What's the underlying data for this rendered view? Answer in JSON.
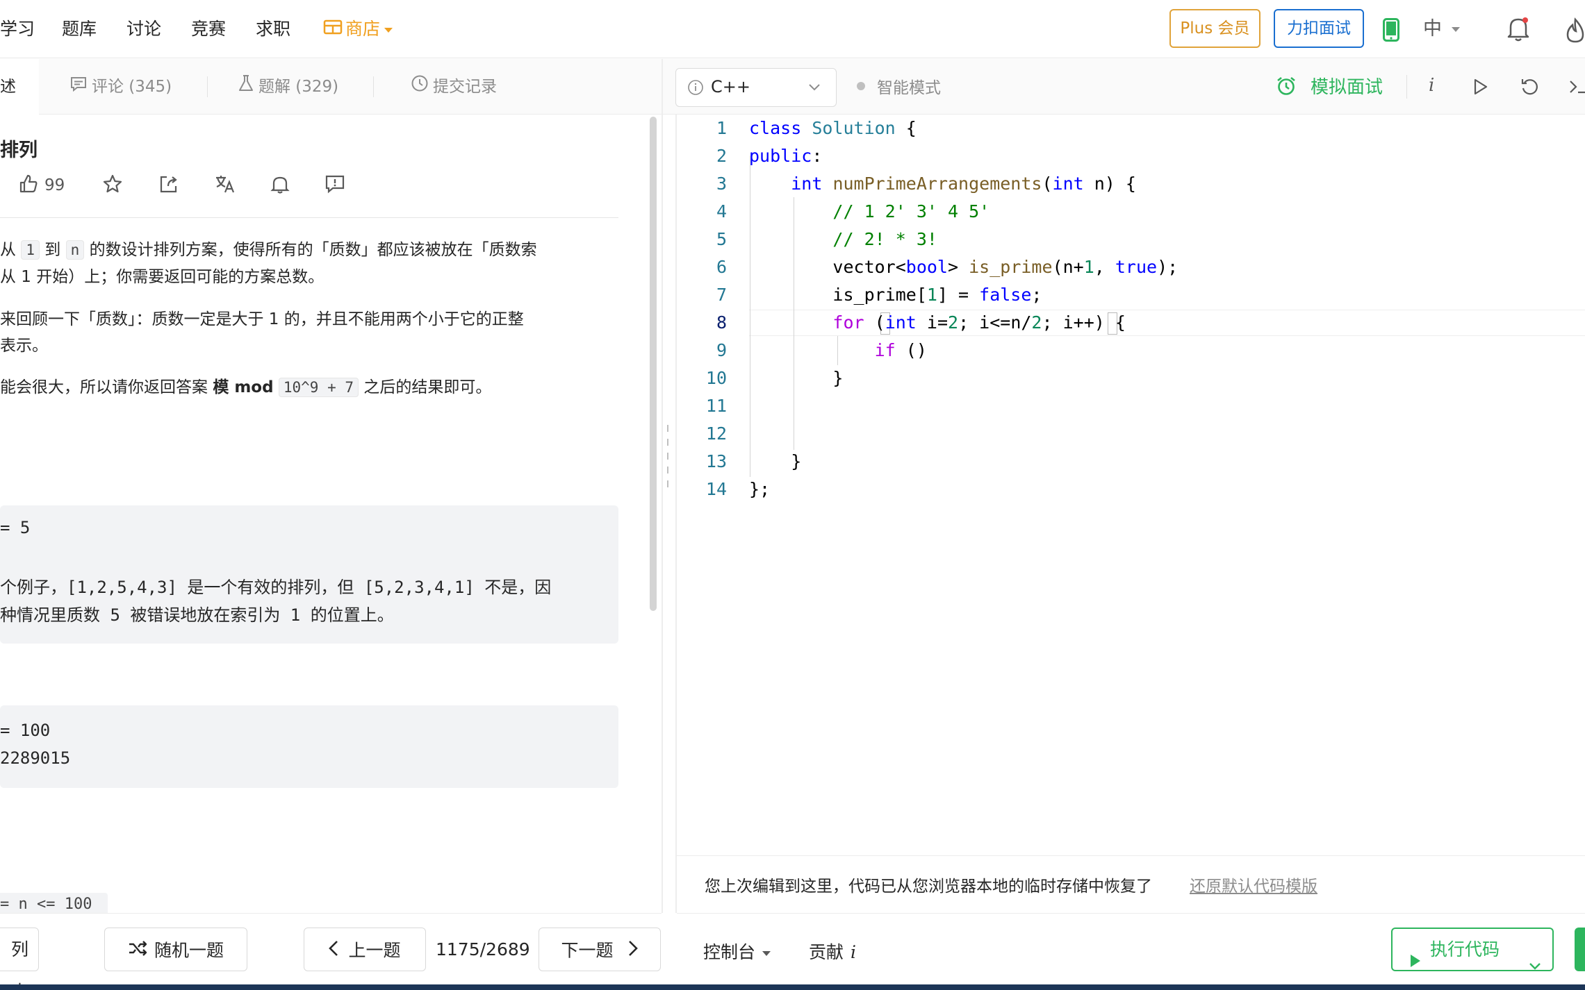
{
  "nav": {
    "items": [
      "学习",
      "题库",
      "讨论",
      "竞赛",
      "求职"
    ],
    "shop_label": "商店",
    "plus_label": "Plus 会员",
    "interview_label": "力扣面试",
    "lang_label": "中"
  },
  "tabs": {
    "partial_tab": "述",
    "comments": "评论 (345)",
    "solutions": "题解 (329)",
    "submissions": "提交记录"
  },
  "problem": {
    "title": "排列",
    "likes": "99",
    "desc1_a": "从",
    "desc1_code1": "1",
    "desc1_b": "到",
    "desc1_code2": "n",
    "desc1_c": "的数设计排列方案，使得所有的「质数」都应该被放在「质数索",
    "desc2": "从 1 开始）上；你需要返回可能的方案总数。",
    "desc3": "来回顾一下「质数」：质数一定是大于 1 的，并且不能用两个小于它的正整",
    "desc4": "表示。",
    "desc5_a": "能会很大，所以请你返回答案",
    "desc5_bold": "模 mod",
    "desc5_code": "10^9 + 7",
    "desc5_b": "之后的结果即可。",
    "example1": [
      "= 5",
      "",
      "个例子，[1,2,5,4,3] 是一个有效的排列，但 [5,2,3,4,1] 不是，因",
      "种情况里质数 5 被错误地放在索引为 1 的位置上。"
    ],
    "example2": [
      "= 100",
      "2289015"
    ],
    "constraint": "= n <= 100"
  },
  "footer_left": {
    "list_label": "列表",
    "random_label": "随机一题",
    "prev_label": "上一题",
    "counter": "1175/2689",
    "next_label": "下一题"
  },
  "editor": {
    "language": "C++",
    "smart_mode": "智能模式",
    "mock_interview": "模拟面试",
    "line_numbers": [
      "1",
      "2",
      "3",
      "4",
      "5",
      "6",
      "7",
      "8",
      "9",
      "10",
      "11",
      "12",
      "13",
      "14"
    ],
    "restore_msg": "您上次编辑到这里，代码已从您浏览器本地的临时存储中恢复了",
    "restore_link": "还原默认代码模版",
    "console_label": "控制台",
    "contribute_label": "贡献",
    "run_label": "执行代码"
  },
  "colors": {
    "accent_green": "#2db55d",
    "plus_orange": "#d99120",
    "interview_blue": "#1a6fd0"
  }
}
